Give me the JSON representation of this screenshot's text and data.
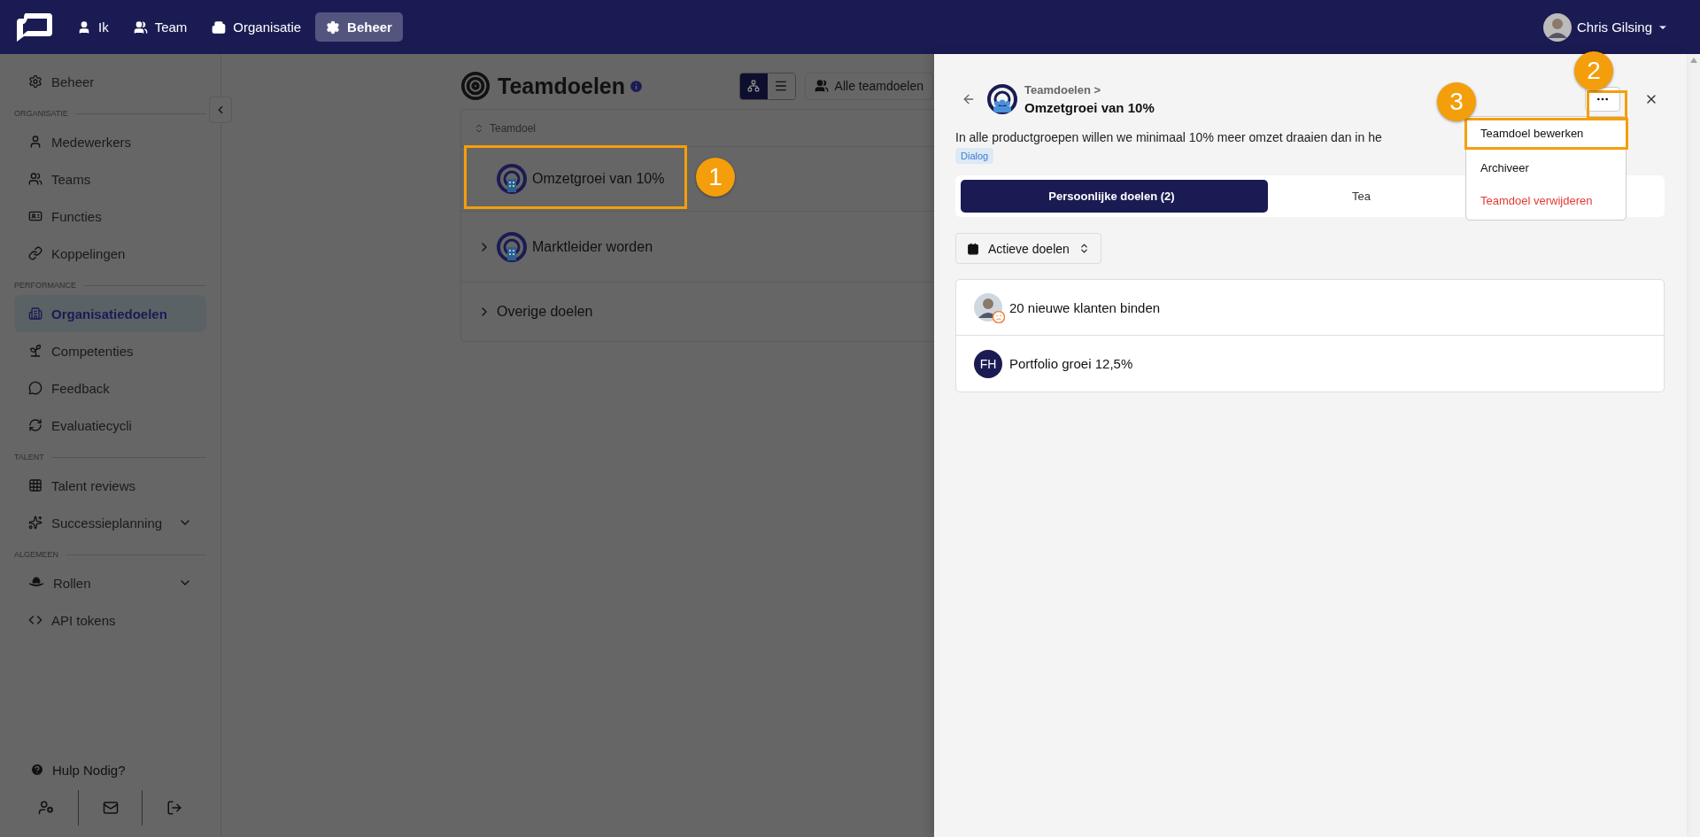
{
  "topbar": {
    "nav": [
      {
        "label": "Ik",
        "selected": false
      },
      {
        "label": "Team",
        "selected": false
      },
      {
        "label": "Organisatie",
        "selected": false
      },
      {
        "label": "Beheer",
        "selected": true
      }
    ],
    "user": {
      "name": "Chris Gilsing"
    }
  },
  "sidebar": {
    "items": [
      {
        "kind": "item",
        "label": "Beheer",
        "selected": false
      },
      {
        "kind": "section",
        "label": "ORGANISATIE"
      },
      {
        "kind": "item",
        "label": "Medewerkers",
        "selected": false
      },
      {
        "kind": "item",
        "label": "Teams",
        "selected": false
      },
      {
        "kind": "item",
        "label": "Functies",
        "selected": false
      },
      {
        "kind": "item",
        "label": "Koppelingen",
        "selected": false
      },
      {
        "kind": "section",
        "label": "PERFORMANCE"
      },
      {
        "kind": "item",
        "label": "Organisatiedoelen",
        "selected": true
      },
      {
        "kind": "item",
        "label": "Competenties",
        "selected": false
      },
      {
        "kind": "item",
        "label": "Feedback",
        "selected": false
      },
      {
        "kind": "item",
        "label": "Evaluatiecycli",
        "selected": false
      },
      {
        "kind": "section",
        "label": "TALENT"
      },
      {
        "kind": "item",
        "label": "Talent reviews",
        "selected": false
      },
      {
        "kind": "group",
        "label": "Successieplanning",
        "selected": false
      },
      {
        "kind": "section",
        "label": "ALGEMEEN"
      },
      {
        "kind": "group",
        "label": "Rollen",
        "selected": false
      },
      {
        "kind": "item",
        "label": "API tokens",
        "selected": false
      }
    ],
    "help": "Hulp Nodig?"
  },
  "main": {
    "title": "Teamdoelen",
    "view_modes": [
      {
        "selected": true
      },
      {
        "selected": false
      }
    ],
    "filter": "Alle teamdoelen",
    "table": {
      "column": "Teamdoel",
      "rows": [
        {
          "kind": "goal",
          "label": "Omzetgroei van 10%",
          "expandable": false
        },
        {
          "kind": "goal",
          "label": "Marktleider worden",
          "expandable": true
        },
        {
          "kind": "group",
          "label": "Overige doelen",
          "expandable": true
        }
      ]
    }
  },
  "panel": {
    "breadcrumb": "Teamdoelen >",
    "title": "Omzetgroei van 10%",
    "description": "In alle productgroepen willen we minimaal 10% meer omzet draaien dan in he",
    "tag": "Dialog",
    "tabs": [
      {
        "label": "Persoonlijke doelen (2)",
        "selected": true
      },
      {
        "label": "Tea",
        "selected": false
      }
    ],
    "filter": "Actieve doelen",
    "goals": [
      {
        "kind": "photo",
        "label": "20 nieuwe klanten binden"
      },
      {
        "kind": "initials",
        "initials": "FH",
        "label": "Portfolio groei 12,5%"
      }
    ],
    "menu": [
      {
        "kind": "normal",
        "label": "Teamdoel bewerken"
      },
      {
        "kind": "normal",
        "label": "Archiveer"
      },
      {
        "kind": "danger",
        "label": "Teamdoel verwijderen"
      }
    ]
  },
  "annotations": [
    {
      "number": "1"
    },
    {
      "number": "2"
    },
    {
      "number": "3"
    }
  ]
}
